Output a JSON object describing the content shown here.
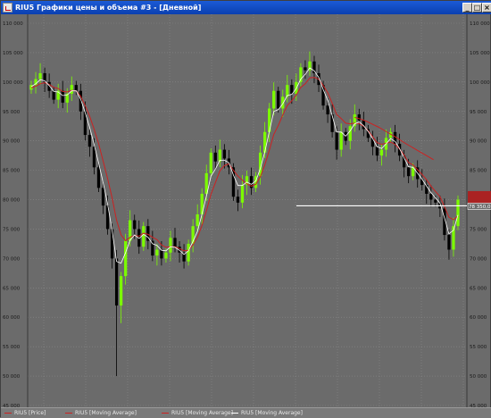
{
  "window": {
    "title": "RIU5 Графики цены и объема #3 - [Дневной]",
    "min_glyph": "_",
    "max_glyph": "□",
    "close_glyph": "×"
  },
  "colors": {
    "background": "#6b6b6b",
    "grid": "#8a8a8a",
    "axis_text": "#1a1a1a",
    "bull": "#7cfc00",
    "bear": "#000000",
    "ma_red": "#cc2222",
    "ma_white": "#ffffff",
    "price_label_bg": "#6b6b6b",
    "red_label_bg": "#aa2222"
  },
  "chart_data": {
    "type": "candlestick",
    "instrument": "RIU5",
    "ylim": [
      45000,
      110000
    ],
    "y_ticks": [
      "45 000",
      "50 000",
      "55 000",
      "60 000",
      "65 000",
      "70 000",
      "75 000",
      "80 000",
      "85 000",
      "90 000",
      "95 000",
      "100 000",
      "105 000",
      "110 000"
    ],
    "y_tick_values": [
      45000,
      50000,
      55000,
      60000,
      65000,
      70000,
      75000,
      80000,
      85000,
      90000,
      95000,
      100000,
      105000,
      110000
    ],
    "last_price_label": "78 350,0",
    "horizontal_level": 78950,
    "red_label_values": [
      81000,
      80300,
      79600
    ],
    "closes": [
      99500,
      100500,
      101500,
      100000,
      98500,
      97000,
      98500,
      96500,
      98000,
      99500,
      98500,
      95000,
      91000,
      89000,
      85500,
      82000,
      79000,
      75000,
      70000,
      62000,
      67000,
      73000,
      76500,
      75000,
      72000,
      75500,
      73000,
      70500,
      71500,
      70000,
      71000,
      73500,
      72000,
      71000,
      69500,
      72500,
      75500,
      77500,
      81000,
      84500,
      88000,
      86500,
      88500,
      87000,
      85500,
      80500,
      79500,
      82500,
      84000,
      82000,
      84000,
      88000,
      91500,
      95500,
      98500,
      95500,
      97500,
      99500,
      98000,
      100000,
      102500,
      102000,
      103500,
      101500,
      99500,
      96000,
      94500,
      91500,
      88500,
      91500,
      90000,
      92500,
      94500,
      93500,
      92000,
      90500,
      89000,
      87500,
      88500,
      90500,
      91500,
      89500,
      87500,
      85500,
      84000,
      85500,
      83500,
      82500,
      81000,
      80000,
      79500,
      78500,
      74000,
      71500,
      75500,
      80000
    ],
    "ma_red": [
      99000,
      99300,
      99700,
      99900,
      99600,
      99100,
      98900,
      98400,
      98300,
      98600,
      98500,
      97600,
      96000,
      94200,
      92000,
      89500,
      86600,
      83600,
      80300,
      76500,
      74000,
      73000,
      73600,
      73900,
      73800,
      74300,
      74100,
      73600,
      73200,
      72300,
      71900,
      72000,
      72000,
      71700,
      71300,
      71400,
      72300,
      73600,
      75600,
      78100,
      80900,
      82900,
      84900,
      85800,
      86100,
      85000,
      84000,
      83300,
      82700,
      82300,
      82600,
      83900,
      85900,
      88400,
      91100,
      92600,
      94400,
      96000,
      96800,
      97800,
      99100,
      99700,
      100700,
      100800,
      100500,
      99400,
      98200,
      96400,
      94500,
      93800,
      93000,
      92900,
      93000,
      92900,
      92500,
      91700,
      90700,
      89700,
      89400,
      89600,
      89800,
      89400,
      88600,
      87600,
      86300,
      85900,
      85100,
      84300,
      83400,
      82300,
      81400,
      80500,
      78800,
      77000,
      76600,
      77200
    ],
    "ma_white": [
      99200,
      99700,
      100400,
      100200,
      99400,
      98400,
      98300,
      97700,
      97800,
      98500,
      98500,
      97100,
      94800,
      92300,
      89400,
      86200,
      82900,
      79300,
      74700,
      69500,
      69200,
      71000,
      73100,
      74000,
      73400,
      74100,
      73600,
      72500,
      72200,
      71400,
      71300,
      72000,
      71900,
      71400,
      70700,
      71300,
      72900,
      74600,
      77500,
      80600,
      84000,
      85200,
      86700,
      86700,
      86300,
      84200,
      82400,
      82400,
      83000,
      82600,
      83200,
      85300,
      88100,
      91600,
      95000,
      95300,
      96300,
      97700,
      97900,
      98900,
      100500,
      101300,
      102400,
      101900,
      100800,
      98700,
      96900,
      94300,
      91500,
      91500,
      90800,
      91700,
      92900,
      93200,
      92600,
      91600,
      90400,
      89000,
      88700,
      89500,
      90400,
      89900,
      88700,
      87100,
      85600,
      85500,
      84500,
      83500,
      82300,
      81200,
      80300,
      79400,
      76900,
      74200,
      74800,
      77400
    ],
    "ma_red_long": [
      94000,
      93700,
      93300,
      92800,
      92300,
      91700,
      91100,
      90500,
      89800,
      89200,
      88600,
      88000,
      87400,
      86800
    ],
    "ma_red_long_start_index": 72
  },
  "legend": [
    {
      "label": "RIU5 [Price]",
      "color": "#cc2222"
    },
    {
      "label": "RIU5 [Moving Average]",
      "color": "#cc2222"
    },
    {
      "label": "RIU5 [Moving Average]",
      "color": "#cc2222"
    },
    {
      "label": "RIU5 [Moving Average]",
      "color": "#ffffff"
    }
  ]
}
